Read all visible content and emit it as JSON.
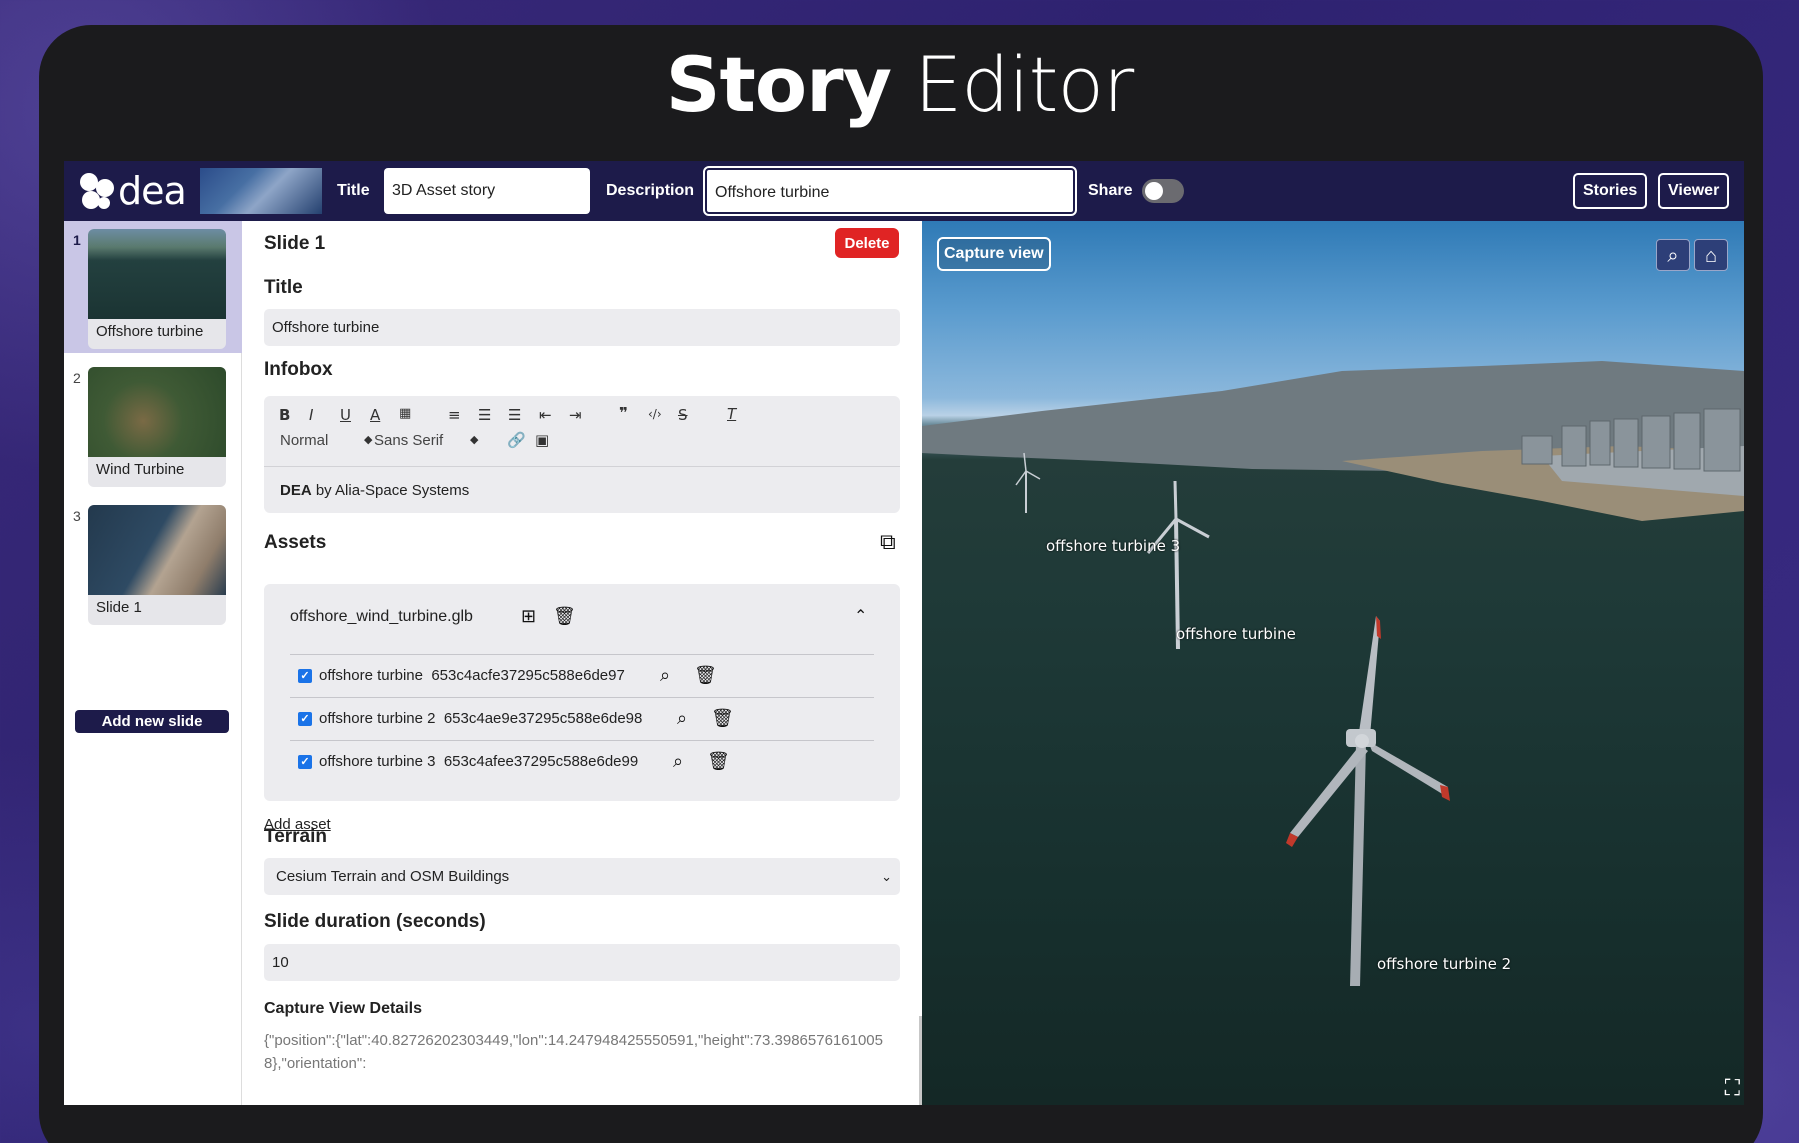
{
  "headline": {
    "bold": "Story",
    "light": " Editor"
  },
  "topbar": {
    "logo_text": "dea",
    "title_label": "Title",
    "title_value": "3D Asset story",
    "description_label": "Description",
    "description_value": "Offshore turbine",
    "share_label": "Share",
    "share_on": false,
    "stories_button": "Stories",
    "viewer_button": "Viewer"
  },
  "sidebar": {
    "slides": [
      {
        "number": "1",
        "title": "Offshore turbine",
        "active": true
      },
      {
        "number": "2",
        "title": "Wind Turbine",
        "active": false
      },
      {
        "number": "3",
        "title": "Slide 1",
        "active": false
      }
    ],
    "add_button": "Add new slide"
  },
  "editor": {
    "slide_heading": "Slide 1",
    "delete_button": "Delete",
    "title_label": "Title",
    "title_value": "Offshore turbine",
    "infobox_label": "Infobox",
    "toolbar": {
      "format_select": "Normal",
      "font_select": "Sans Serif"
    },
    "infobox_content_bold": "DEA",
    "infobox_content_rest": " by Alia-Space Systems",
    "assets_label": "Assets",
    "asset_file": "offshore_wind_turbine.glb",
    "assets": [
      {
        "name": "offshore turbine",
        "id": "653c4acfe37295c588e6de97",
        "checked": true
      },
      {
        "name": "offshore turbine 2",
        "id": "653c4ae9e37295c588e6de98",
        "checked": true
      },
      {
        "name": "offshore turbine 3",
        "id": "653c4afee37295c588e6de99",
        "checked": true
      }
    ],
    "add_asset": "Add asset",
    "terrain_label": "Terrain",
    "terrain_value": "Cesium Terrain and OSM Buildings",
    "duration_label": "Slide duration (seconds)",
    "duration_value": "10",
    "capture_details_label": "Capture View Details",
    "capture_details_text": "{\"position\":{\"lat\":40.82726202303449,\"lon\":14.247948425550591,\"height\":73.39865761610058},\"orientation\":"
  },
  "viewer": {
    "capture_button": "Capture view",
    "labels": {
      "turbine_3": "offshore turbine 3",
      "turbine_1": "offshore turbine",
      "turbine_2": "offshore turbine 2"
    }
  }
}
